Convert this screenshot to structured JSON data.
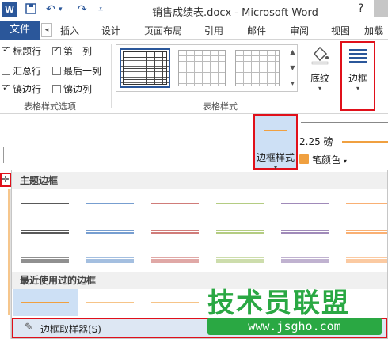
{
  "titlebar": {
    "app_icon": "W",
    "doc_title": "销售成绩表.docx - Microsoft Word",
    "help": "?",
    "icons": [
      "save-icon",
      "undo-icon",
      "redo-icon",
      "customize-qat-icon"
    ]
  },
  "tabs": {
    "file": "文件",
    "scroll": "◂",
    "items": [
      "插入",
      "设计",
      "页面布局",
      "引用",
      "邮件",
      "审阅",
      "视图",
      "加载"
    ]
  },
  "table_style_options": {
    "label": "表格样式选项",
    "items": [
      {
        "label": "标题行",
        "checked": true
      },
      {
        "label": "第一列",
        "checked": true
      },
      {
        "label": "汇总行",
        "checked": false
      },
      {
        "label": "最后一列",
        "checked": false
      },
      {
        "label": "镶边行",
        "checked": true
      },
      {
        "label": "镶边列",
        "checked": false
      }
    ]
  },
  "table_styles": {
    "label": "表格样式"
  },
  "shading": {
    "label": "底纹"
  },
  "borders": {
    "label": "边框"
  },
  "border_style": {
    "label": "边框样式",
    "line_color": "#f0a040"
  },
  "pen": {
    "weight": "2.25 磅",
    "color_label": "笔颜色",
    "color": "#f0a040"
  },
  "dropdown": {
    "theme_heading": "主题边框",
    "recent_heading": "最近使用过的边框",
    "painter_label": "边框取样器(S)",
    "theme_colors": [
      "#222222",
      "#4a7fc1",
      "#c0504d",
      "#9bbb59",
      "#8064a2",
      "#f79646"
    ]
  },
  "watermark": {
    "text": "技术员联盟",
    "url": "www.jsgho.com"
  },
  "accent": "#2b579a",
  "highlight": "#e0101a"
}
